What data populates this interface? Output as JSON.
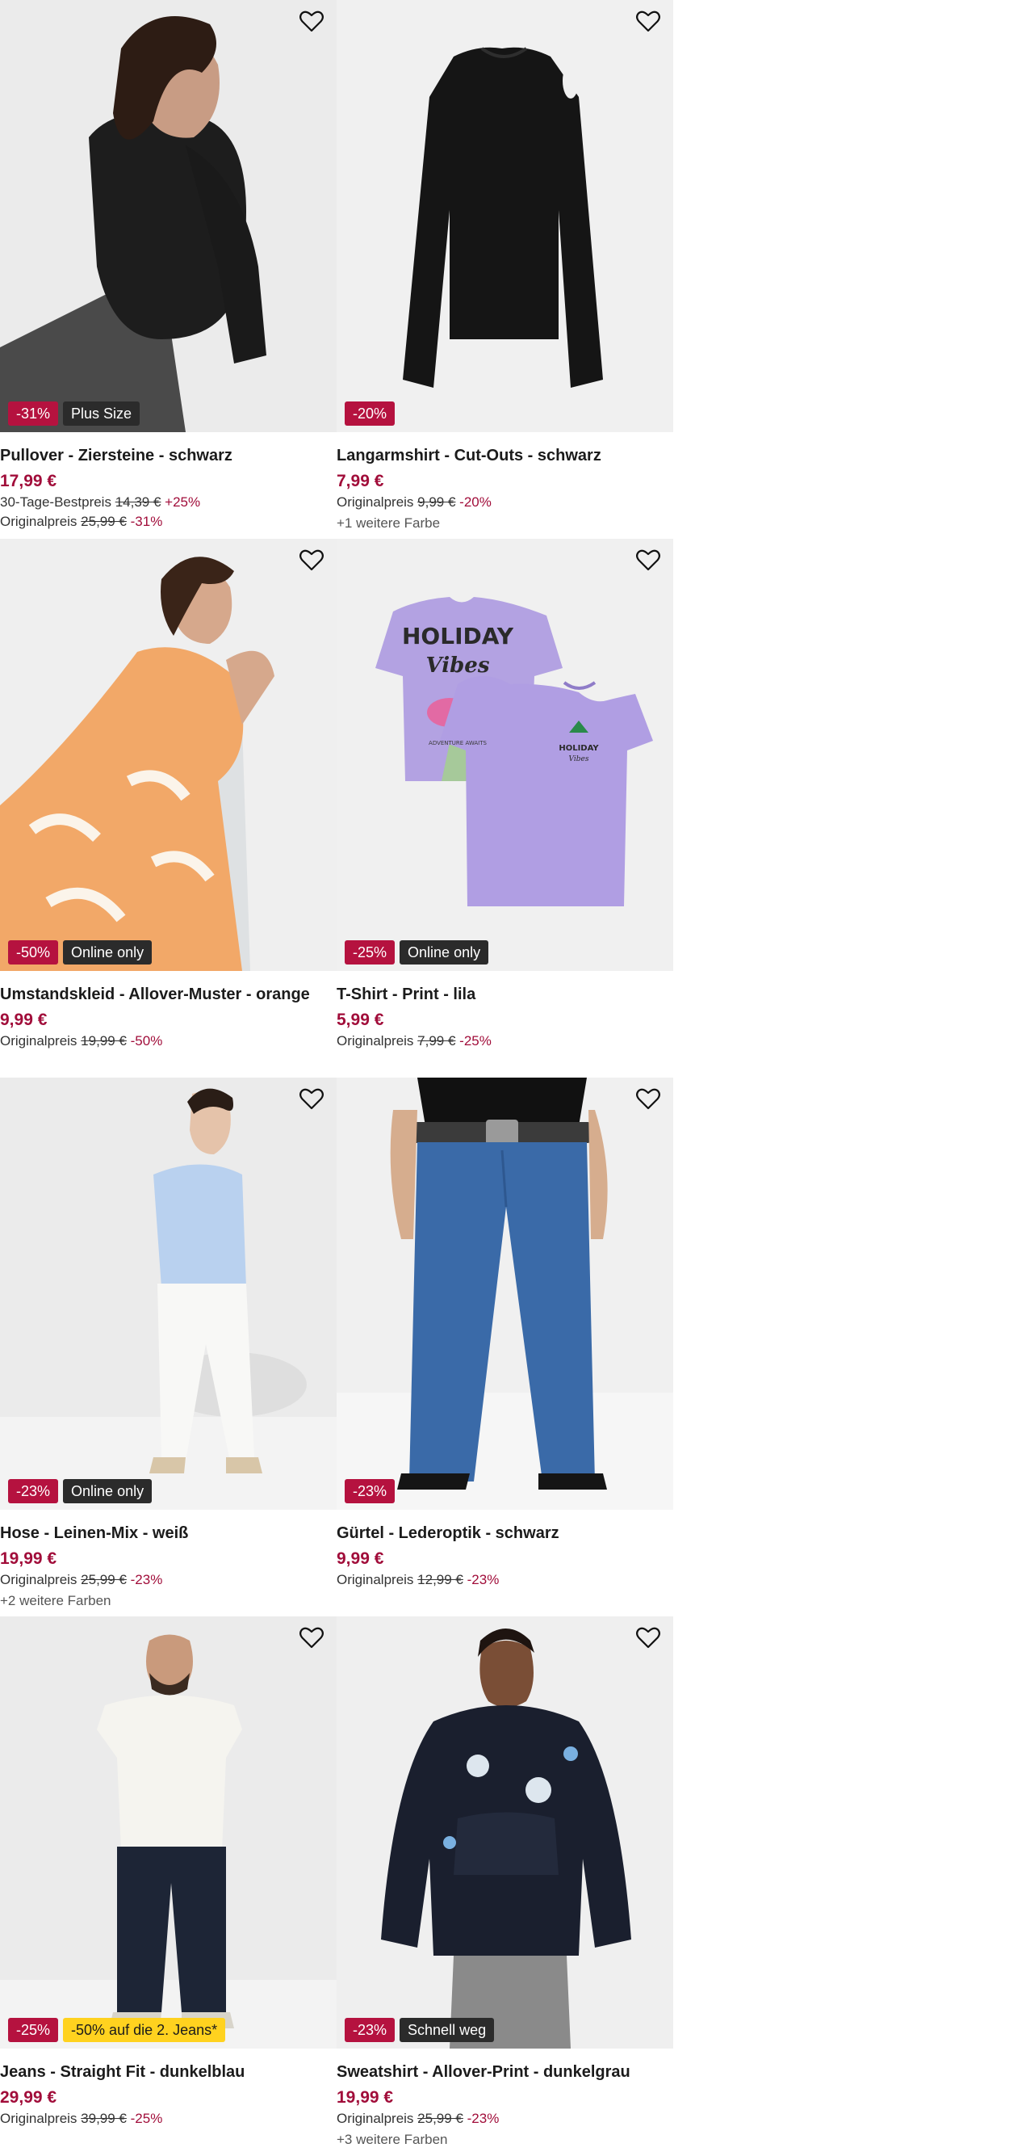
{
  "products": [
    {
      "title": "Pullover - Ziersteine - schwarz",
      "price": "17,99 €",
      "badges": [
        {
          "text": "-31%",
          "style": "disc"
        },
        {
          "text": "Plus Size",
          "style": "dark"
        }
      ],
      "lines": [
        {
          "label": "30-Tage-Bestpreis",
          "old": "14,39 €",
          "pct": "+25%"
        },
        {
          "label": "Originalpreis",
          "old": "25,99 €",
          "pct": "-31%"
        }
      ],
      "more": ""
    },
    {
      "title": "Langarmshirt - Cut-Outs - schwarz",
      "price": "7,99 €",
      "badges": [
        {
          "text": "-20%",
          "style": "disc"
        }
      ],
      "lines": [
        {
          "label": "Originalpreis",
          "old": "9,99 €",
          "pct": "-20%"
        }
      ],
      "more": "+1 weitere Farbe"
    },
    {
      "title": "Umstandskleid - Allover-Muster - orange",
      "price": "9,99 €",
      "badges": [
        {
          "text": "-50%",
          "style": "disc"
        },
        {
          "text": "Online only",
          "style": "dark"
        }
      ],
      "lines": [
        {
          "label": "Originalpreis",
          "old": "19,99 €",
          "pct": "-50%"
        }
      ],
      "more": ""
    },
    {
      "title": "T-Shirt - Print - lila",
      "price": "5,99 €",
      "badges": [
        {
          "text": "-25%",
          "style": "disc"
        },
        {
          "text": "Online only",
          "style": "dark"
        }
      ],
      "lines": [
        {
          "label": "Originalpreis",
          "old": "7,99 €",
          "pct": "-25%"
        }
      ],
      "more": ""
    },
    {
      "title": "Hose - Leinen-Mix - weiß",
      "price": "19,99 €",
      "badges": [
        {
          "text": "-23%",
          "style": "disc"
        },
        {
          "text": "Online only",
          "style": "dark"
        }
      ],
      "lines": [
        {
          "label": "Originalpreis",
          "old": "25,99 €",
          "pct": "-23%"
        }
      ],
      "more": "+2 weitere Farben"
    },
    {
      "title": "Gürtel - Lederoptik - schwarz",
      "price": "9,99 €",
      "badges": [
        {
          "text": "-23%",
          "style": "disc"
        }
      ],
      "lines": [
        {
          "label": "Originalpreis",
          "old": "12,99 €",
          "pct": "-23%"
        }
      ],
      "more": ""
    },
    {
      "title": "Jeans - Straight Fit - dunkelblau",
      "price": "29,99 €",
      "badges": [
        {
          "text": "-25%",
          "style": "disc"
        },
        {
          "text": "-50% auf die 2. Jeans*",
          "style": "yellow"
        }
      ],
      "lines": [
        {
          "label": "Originalpreis",
          "old": "39,99 €",
          "pct": "-25%"
        }
      ],
      "more": ""
    },
    {
      "title": "Sweatshirt - Allover-Print - dunkelgrau",
      "price": "19,99 €",
      "badges": [
        {
          "text": "-23%",
          "style": "disc"
        },
        {
          "text": "Schnell weg",
          "style": "dark"
        }
      ],
      "lines": [
        {
          "label": "Originalpreis",
          "old": "25,99 €",
          "pct": "-23%"
        }
      ],
      "more": "+3 weitere Farben"
    }
  ],
  "print": {
    "holiday": "HOLIDAY",
    "vibes": "Vibes",
    "adventure": "ADVENTURE AWAITS",
    "small_holiday": "HOLIDAY",
    "small_vibes": "Vibes"
  },
  "colors": {
    "discount": "#b5123f",
    "price": "#a10d3a",
    "badge_dark": "#2b2b2b",
    "badge_yellow": "#ffd21f",
    "image_bg": "#f0f0f0"
  }
}
